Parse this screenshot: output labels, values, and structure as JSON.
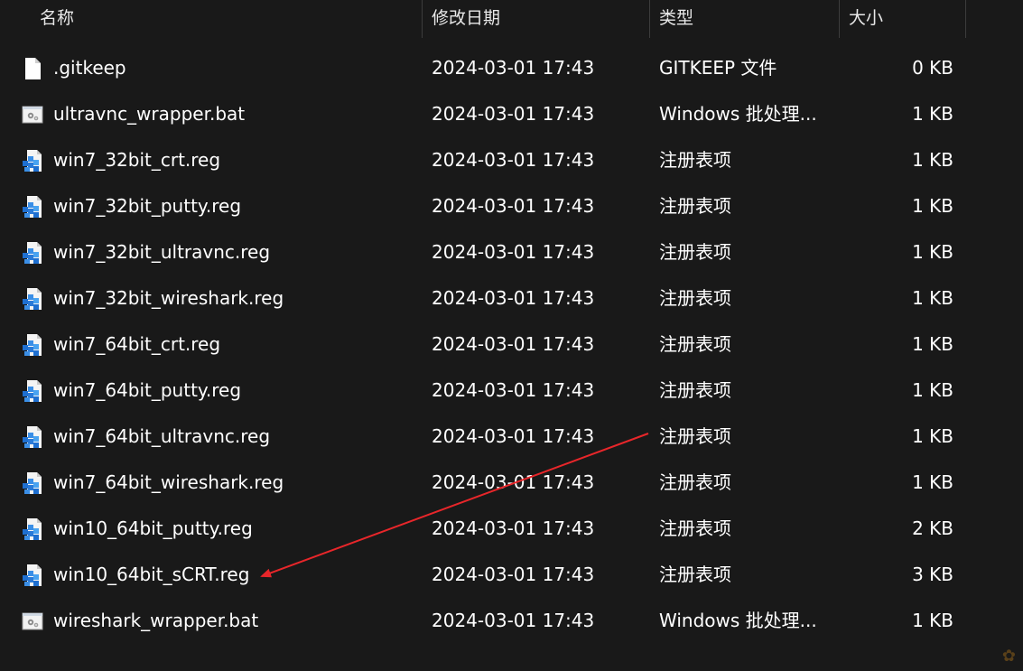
{
  "columns": {
    "name": "名称",
    "date": "修改日期",
    "type": "类型",
    "size": "大小"
  },
  "files": [
    {
      "name": ".gitkeep",
      "date": "2024-03-01 17:43",
      "type": "GITKEEP 文件",
      "size": "0 KB",
      "icon": "blank-file-icon"
    },
    {
      "name": "ultravnc_wrapper.bat",
      "date": "2024-03-01 17:43",
      "type": "Windows 批处理...",
      "size": "1 KB",
      "icon": "batch-file-icon"
    },
    {
      "name": "win7_32bit_crt.reg",
      "date": "2024-03-01 17:43",
      "type": "注册表项",
      "size": "1 KB",
      "icon": "registry-file-icon"
    },
    {
      "name": "win7_32bit_putty.reg",
      "date": "2024-03-01 17:43",
      "type": "注册表项",
      "size": "1 KB",
      "icon": "registry-file-icon"
    },
    {
      "name": "win7_32bit_ultravnc.reg",
      "date": "2024-03-01 17:43",
      "type": "注册表项",
      "size": "1 KB",
      "icon": "registry-file-icon"
    },
    {
      "name": "win7_32bit_wireshark.reg",
      "date": "2024-03-01 17:43",
      "type": "注册表项",
      "size": "1 KB",
      "icon": "registry-file-icon"
    },
    {
      "name": "win7_64bit_crt.reg",
      "date": "2024-03-01 17:43",
      "type": "注册表项",
      "size": "1 KB",
      "icon": "registry-file-icon"
    },
    {
      "name": "win7_64bit_putty.reg",
      "date": "2024-03-01 17:43",
      "type": "注册表项",
      "size": "1 KB",
      "icon": "registry-file-icon"
    },
    {
      "name": "win7_64bit_ultravnc.reg",
      "date": "2024-03-01 17:43",
      "type": "注册表项",
      "size": "1 KB",
      "icon": "registry-file-icon"
    },
    {
      "name": "win7_64bit_wireshark.reg",
      "date": "2024-03-01 17:43",
      "type": "注册表项",
      "size": "1 KB",
      "icon": "registry-file-icon"
    },
    {
      "name": "win10_64bit_putty.reg",
      "date": "2024-03-01 17:43",
      "type": "注册表项",
      "size": "2 KB",
      "icon": "registry-file-icon"
    },
    {
      "name": "win10_64bit_sCRT.reg",
      "date": "2024-03-01 17:43",
      "type": "注册表项",
      "size": "3 KB",
      "icon": "registry-file-icon"
    },
    {
      "name": "wireshark_wrapper.bat",
      "date": "2024-03-01 17:43",
      "type": "Windows 批处理...",
      "size": "1 KB",
      "icon": "batch-file-icon"
    }
  ],
  "annotation": {
    "arrow_color": "#e8262a"
  },
  "colors": {
    "background": "#191919",
    "text": "#ffffff",
    "separator": "#3c3c3c"
  }
}
